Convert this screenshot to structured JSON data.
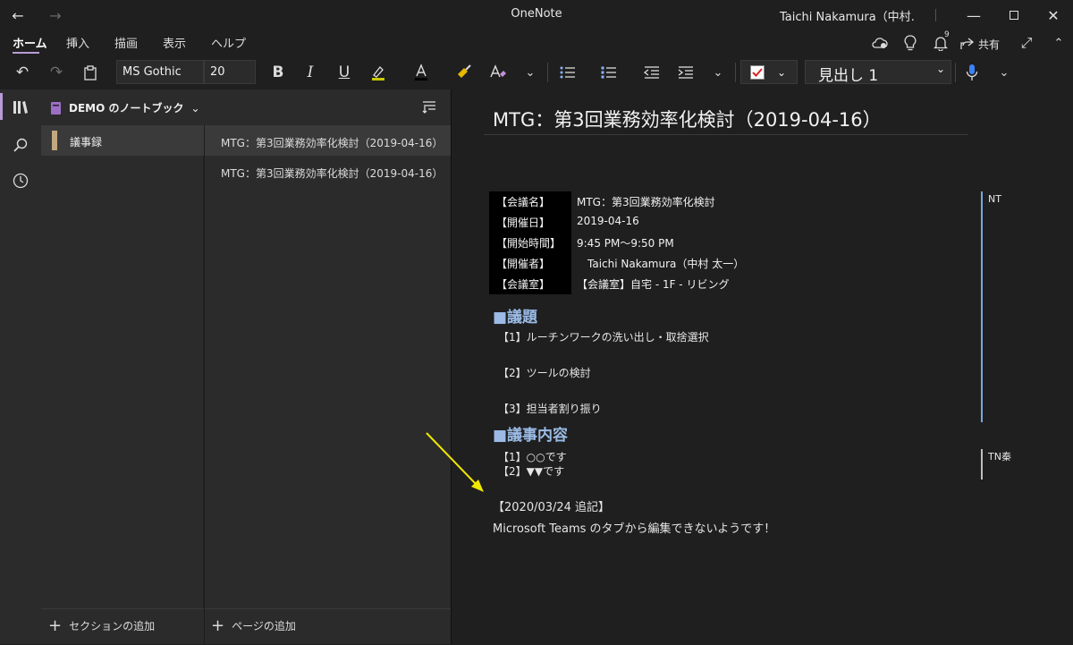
{
  "window": {
    "title": "OneNote",
    "user": "Taichi Nakamura（中村…"
  },
  "ribbon": {
    "tabs": [
      "ホーム",
      "挿入",
      "描画",
      "表示",
      "ヘルプ"
    ],
    "share_label": "共有",
    "notification_count": "9"
  },
  "toolbar": {
    "font_name": "MS Gothic",
    "font_size": "20",
    "style": "見出し 1"
  },
  "notebook": {
    "name": "DEMO のノートブック",
    "sections": [
      "議事録"
    ],
    "pages": [
      "MTG：第3回業務効率化検討（2019-04-16）",
      "MTG：第3回業務効率化検討（2019-04-16）"
    ],
    "add_section": "セクションの追加",
    "add_page": "ページの追加"
  },
  "page": {
    "title": "MTG：第3回業務効率化検討（2019-04-16）",
    "meta": [
      {
        "label": "【会議名】",
        "value": "MTG：第3回業務効率化検討"
      },
      {
        "label": "【開催日】",
        "value": "2019-04-16"
      },
      {
        "label": "【開始時間】",
        "value": "9:45 PM～9:50 PM"
      },
      {
        "label": "【開催者】",
        "value": "　Taichi Nakamura（中村 太一）"
      },
      {
        "label": "【会議室】",
        "value": "【会議室】自宅 - 1F - リビング"
      }
    ],
    "agenda_heading": "■議題",
    "agenda": [
      "【1】ルーチンワークの洗い出し・取捨選択",
      "【2】ツールの検討",
      "【3】担当者割り振り"
    ],
    "minutes_heading": "■議事内容",
    "minutes": [
      "【1】○○です",
      "【2】▼▼です"
    ],
    "note_header": "【2020/03/24 追記】",
    "note_body": "Microsoft Teams のタブから編集できないようです！",
    "authors": [
      "NT",
      "TN秦"
    ]
  },
  "colors": {
    "accent": "#b99bd6",
    "heading": "#9bbbe6",
    "author_bar_1": "#7aa7e0",
    "author_bar_2": "#bfbfbf",
    "arrow": "#f0e800"
  }
}
